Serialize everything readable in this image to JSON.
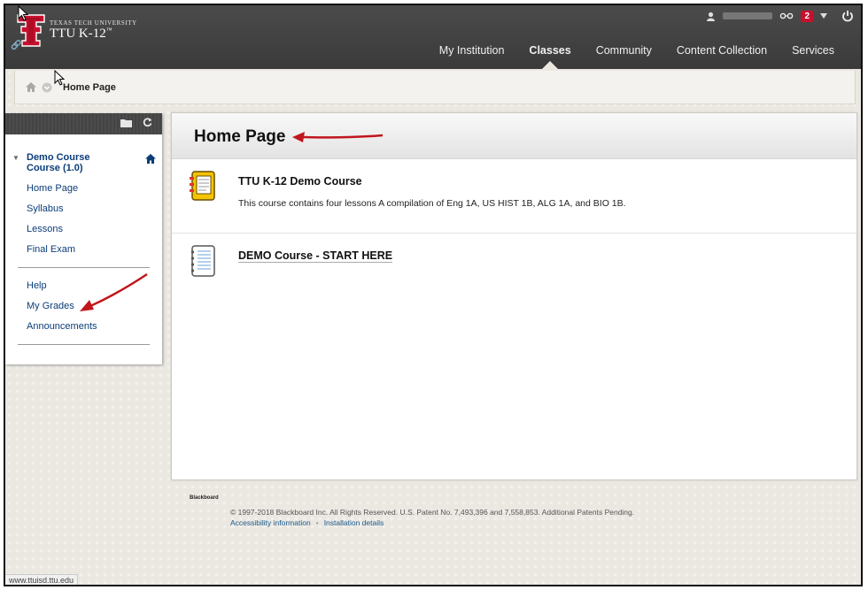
{
  "header": {
    "brand_small": "TEXAS TECH UNIVERSITY",
    "brand_big": "TTU K-12",
    "brand_mark": "™",
    "notification_count": "2",
    "nav": [
      {
        "label": "My Institution"
      },
      {
        "label": "Classes"
      },
      {
        "label": "Community"
      },
      {
        "label": "Content Collection"
      },
      {
        "label": "Services"
      }
    ]
  },
  "breadcrumb": {
    "current": "Home Page"
  },
  "menu": {
    "course_title": "Demo Course Course (1.0)",
    "links_top": [
      "Home Page",
      "Syllabus",
      "Lessons",
      "Final Exam"
    ],
    "links_bottom": [
      "Help",
      "My Grades",
      "Announcements"
    ]
  },
  "content": {
    "title": "Home Page",
    "items": [
      {
        "title": "TTU K-12 Demo Course",
        "description": "This course contains four lessons A compilation of Eng 1A, US HIST 1B, ALG 1A, and BIO 1B."
      },
      {
        "title": "DEMO Course - START HERE"
      }
    ]
  },
  "footer": {
    "logo": "Blackboard",
    "copyright": "© 1997-2018 Blackboard Inc. All Rights Reserved. U.S. Patent No. 7,493,396 and 7,558,853. Additional Patents Pending.",
    "accessibility": "Accessibility information",
    "separator": "•",
    "installation": "Installation details"
  },
  "status_url": "www.ttuisd.ttu.edu",
  "colors": {
    "header_bg": "#3f3f3f",
    "link": "#0b3c78",
    "brand_red": "#c8102e",
    "annotation_arrow": "#c0161c"
  }
}
